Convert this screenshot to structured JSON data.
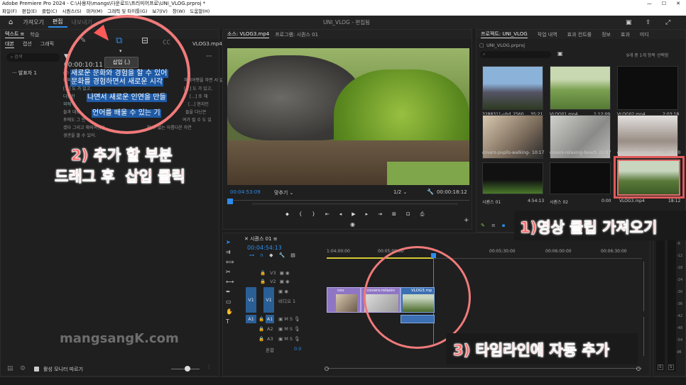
{
  "title_bar": {
    "text": "Adobe Premiere Pro 2024 - C:\\사용자\\mangs\\다운로드\\프리미어프로\\UNI_VLOG.prproj *",
    "controls": [
      "—",
      "☐",
      "✕"
    ]
  },
  "menu": [
    "파일(F)",
    "편집(E)",
    "클립(C)",
    "시퀀스(S)",
    "마커(M)",
    "그래픽 및 타이틀(G)",
    "보기(V)",
    "창(W)",
    "도움말(H)"
  ],
  "workspaces": {
    "items": [
      "가져오기",
      "편집",
      "내보내기"
    ],
    "active": "편집",
    "project_title": "UNI_VLOG - 편집됨"
  },
  "text_panel": {
    "tabs": [
      "텍스트 ≡",
      "학습"
    ],
    "subtabs": [
      "대본",
      "캡션",
      "그래픽"
    ],
    "clip_name": "VLOG3.mp4",
    "search_placeholder": "검색",
    "timecode": "00:00:10:11",
    "speaker": "발표자 1",
    "transcript_lines": [
      "새로운 문화와 경험을 할 수 있어",
      "문화를 경험하면서 새로운 시각",
      "나면서 새로운 인연을 만들",
      "언어를 배울 수 있는 기"
    ],
    "transcript_side": [
      "해외여행을 하면 서 같아",
      "[...] 도 가 있고,",
      "다양한",
      "외에",
      "[...] 또 해",
      "[...] 현지인",
      "들과 대화",
      "들을 다닌은",
      "후에도 그 언",
      "여가 될 수 도 있",
      "겠다 그리고 해외여행은",
      "할 수 없는 아름다운 자연",
      "경관을 볼 수 있어."
    ],
    "insert_tooltip": "삽입 (,)",
    "bottom_label": "활성 모니터 따르기"
  },
  "source_monitor": {
    "tab": "소스: VLOG3.mp4",
    "program_tab": "프로그램: 시퀀스 01",
    "timecode_left": "00:04:53:09",
    "fit": "맞추기",
    "ratio": "1/2",
    "timecode_right": "00:00:18:12"
  },
  "project_panel": {
    "tabs": [
      "프로젝트: UNI_VLOG",
      "작업 내역",
      "효과 컨트롤",
      "정보",
      "효과",
      "미디"
    ],
    "file": "UNI_VLOG.prproj",
    "selection_info": "9개 중 1개 항목 선택함",
    "items": [
      {
        "name": "3288311-uhd_2560_...",
        "dur": "35:21"
      },
      {
        "name": "VLOG01.mp4",
        "dur": "1:12:09"
      },
      {
        "name": "VLOG02.mp4",
        "dur": "2:03:18"
      },
      {
        "name": "covers-pupils-walking-...",
        "dur": "10:17"
      },
      {
        "name": "covers-relaxing-beach...",
        "dur": "22:07"
      },
      {
        "name": "covers-glasses-and-n...",
        "dur": "18:20"
      },
      {
        "name": "시퀀스 01",
        "dur": "4:54:13"
      },
      {
        "name": "시퀀스 02",
        "dur": "0:00"
      },
      {
        "name": "VLOG3.mp4",
        "dur": "18:12"
      }
    ]
  },
  "timeline": {
    "tab": "시퀀스 01",
    "timecode": "00:04:54:13",
    "ruler": [
      "1:04:00:00",
      "00:05:00:00",
      "00:05:30:00",
      "00:06:00:00",
      "00:06:30:00"
    ],
    "tracks_video": [
      "V3",
      "V2",
      "V1"
    ],
    "tracks_audio": [
      "A1",
      "A2",
      "A3"
    ],
    "v1_label": "비디오 1",
    "mix_label": "혼합",
    "mix_value": "0.0",
    "clips": [
      "cov",
      "covers-relaxin",
      "VLOG3.mp"
    ]
  },
  "annotations": {
    "step1": "1)영상 클립 가져오기",
    "step2_line1": "2) 추가 할 부분",
    "step2_line2": "드래그 후  삽입 클릭",
    "step3": "3) 타임라인에 자동 추가",
    "watermark": "mangsangK.com"
  },
  "colors": {
    "accent": "#2d8ceb",
    "annotation": "#ff6e6e",
    "circle": "#f07a7a",
    "playhead": "#2d8ceb"
  }
}
